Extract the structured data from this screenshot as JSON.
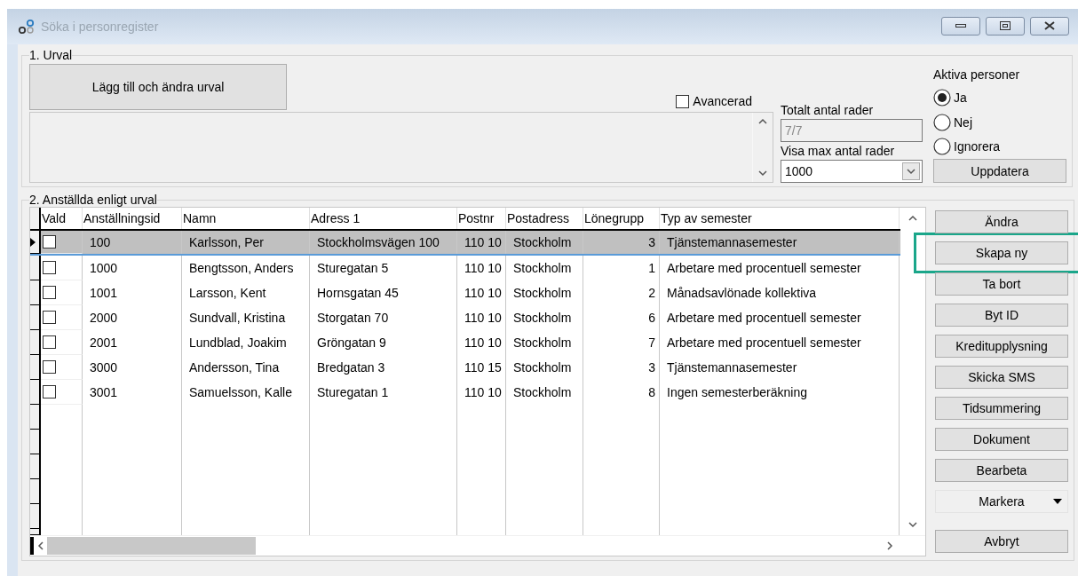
{
  "window": {
    "title": "Söka i personregister"
  },
  "selection": {
    "legend": "1. Urval",
    "edit_button": "Lägg till och ändra urval",
    "advanced": {
      "label": "Avancerad",
      "checked": false
    },
    "total_rows": {
      "label": "Totalt antal rader",
      "value": "7/7"
    },
    "max_rows": {
      "label": "Visa max antal rader",
      "value": "1000"
    },
    "active_persons": {
      "label": "Aktiva personer",
      "options": [
        {
          "label": "Ja",
          "selected": true
        },
        {
          "label": "Nej",
          "selected": false
        },
        {
          "label": "Ignorera",
          "selected": false
        }
      ]
    },
    "update_button": "Uppdatera"
  },
  "employees": {
    "legend": "2. Anställda enligt urval",
    "table": {
      "check_column": "Vald",
      "columns": [
        "Anställningsid",
        "Namn",
        "Adress 1",
        "Postnr",
        "Postadress",
        "Lönegrupp",
        "Typ av semester"
      ],
      "rows": [
        {
          "selected": true,
          "checked": false,
          "cells": [
            "100",
            "Karlsson, Per",
            "Stockholmsvägen 100",
            "110 10",
            "Stockholm",
            "3",
            "Tjänstemannasemester"
          ]
        },
        {
          "selected": false,
          "checked": false,
          "cells": [
            "1000",
            "Bengtsson, Anders",
            "Sturegatan 5",
            "110 10",
            "Stockholm",
            "1",
            "Arbetare med procentuell semester"
          ]
        },
        {
          "selected": false,
          "checked": false,
          "cells": [
            "1001",
            "Larsson, Kent",
            "Hornsgatan 45",
            "110 10",
            "Stockholm",
            "2",
            "Månadsavlönade kollektiva"
          ]
        },
        {
          "selected": false,
          "checked": false,
          "cells": [
            "2000",
            "Sundvall, Kristina",
            "Storgatan 70",
            "110 10",
            "Stockholm",
            "6",
            "Arbetare med procentuell semester"
          ]
        },
        {
          "selected": false,
          "checked": false,
          "cells": [
            "2001",
            "Lundblad, Joakim",
            "Gröngatan 9",
            "110 10",
            "Stockholm",
            "7",
            "Arbetare med procentuell semester"
          ]
        },
        {
          "selected": false,
          "checked": false,
          "cells": [
            "3000",
            "Andersson, Tina",
            "Bredgatan 3",
            "110 15",
            "Stockholm",
            "3",
            "Tjänstemannasemester"
          ]
        },
        {
          "selected": false,
          "checked": false,
          "cells": [
            "3001",
            "Samuelsson, Kalle",
            "Sturegatan 1",
            "110 10",
            "Stockholm",
            "8",
            "Ingen semesterberäkning"
          ]
        }
      ]
    },
    "buttons": [
      {
        "label": "Ändra",
        "kind": "button",
        "highlighted": false
      },
      {
        "label": "Skapa ny",
        "kind": "button",
        "highlighted": true
      },
      {
        "label": "Ta bort",
        "kind": "button",
        "highlighted": false
      },
      {
        "label": "Byt ID",
        "kind": "button",
        "highlighted": false
      },
      {
        "label": "Kreditupplysning",
        "kind": "button",
        "highlighted": false
      },
      {
        "label": "Skicka SMS",
        "kind": "button",
        "highlighted": false
      },
      {
        "label": "Tidsummering",
        "kind": "button",
        "highlighted": false
      },
      {
        "label": "Dokument",
        "kind": "button",
        "highlighted": false
      },
      {
        "label": "Bearbeta",
        "kind": "button",
        "highlighted": false
      },
      {
        "label": "Markera",
        "kind": "menu",
        "highlighted": false
      }
    ],
    "cancel_button": "Avbryt"
  }
}
